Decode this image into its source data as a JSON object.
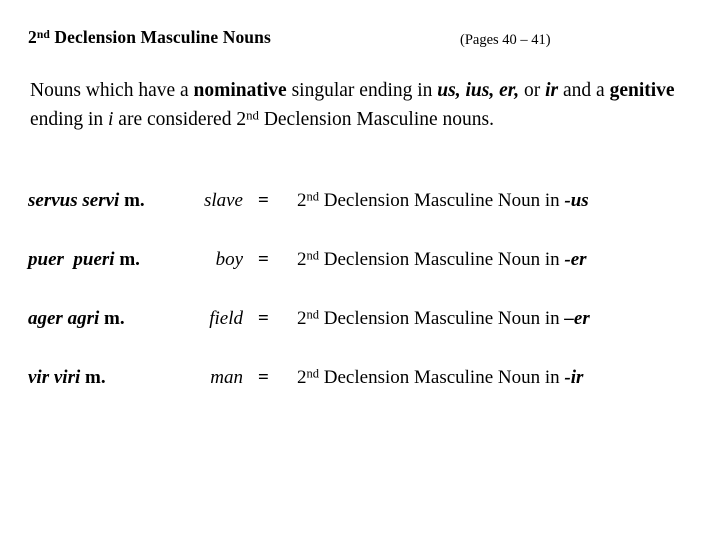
{
  "header": {
    "title_prefix": "2",
    "title_sup": "nd",
    "title_rest": " Declension Masculine Nouns",
    "page_ref": "(Pages 40 – 41)"
  },
  "body": {
    "seg1": "Nouns which have a ",
    "seg2_bold": "nominative",
    "seg3": " singular ending in ",
    "seg4_bolditalic": "us, ius, er,",
    "seg5": " or ",
    "seg6_bolditalic": "ir",
    "seg7": " and a ",
    "seg8_bold": "genitive",
    "seg9": " ending in ",
    "seg10_italic": "i",
    "seg11": " are considered 2",
    "seg12_sup": "nd",
    "seg13": " Declension Masculine nouns."
  },
  "rows": [
    {
      "latin": "servus servi",
      "gender": " m.",
      "gloss": "slave",
      "equals": "=",
      "expansion_prefix": "2",
      "expansion_sup": "nd",
      "expansion_mid": " Declension Masculine Noun in ",
      "expansion_suffix": "-us"
    },
    {
      "latin": "puer  pueri",
      "gender": " m.",
      "gloss": "boy",
      "equals": "=",
      "expansion_prefix": "2",
      "expansion_sup": "nd",
      "expansion_mid": " Declension Masculine Noun in ",
      "expansion_suffix": "-er"
    },
    {
      "latin": "ager agri",
      "gender": " m.",
      "gloss": "field",
      "equals": "=",
      "expansion_prefix": "2",
      "expansion_sup": "nd",
      "expansion_mid": " Declension Masculine Noun in ",
      "expansion_suffix": "–er"
    },
    {
      "latin": "vir viri",
      "gender": " m.",
      "gloss": "man",
      "equals": "=",
      "expansion_prefix": "2",
      "expansion_sup": "nd",
      "expansion_mid": " Declension Masculine Noun in ",
      "expansion_suffix": "-ir"
    }
  ]
}
